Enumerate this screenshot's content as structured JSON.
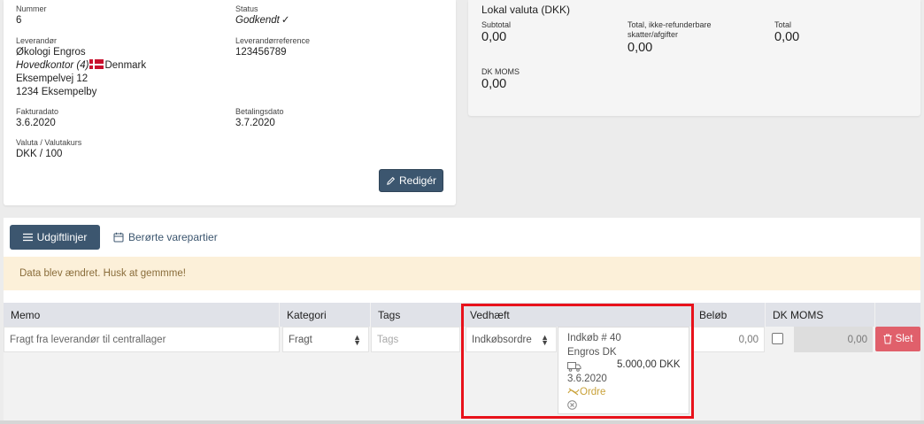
{
  "invoice": {
    "number_label": "Nummer",
    "number_value": "6",
    "status_label": "Status",
    "status_value": "Godkendt",
    "supplier_label": "Leverandør",
    "supplier_name": "Økologi Engros",
    "supplier_branch": "Hovedkontor (4)",
    "supplier_country": "Denmark",
    "supplier_street": "Eksempelvej 12",
    "supplier_city": "1234 Eksempelby",
    "supplier_ref_label": "Leverandørreference",
    "supplier_ref_value": "123456789",
    "invoice_date_label": "Fakturadato",
    "invoice_date_value": "3.6.2020",
    "payment_date_label": "Betalingsdato",
    "payment_date_value": "3.7.2020",
    "currency_label": "Valuta / Valutakurs",
    "currency_value": "DKK / 100",
    "edit_button": "Redigér"
  },
  "local_currency": {
    "title": "Lokal valuta (DKK)",
    "subtotal_label": "Subtotal",
    "subtotal_value": "0,00",
    "nonrefund_label_1": "Total, ikke-refunderbare",
    "nonrefund_label_2": "skatter/afgifter",
    "nonrefund_value": "0,00",
    "total_label": "Total",
    "total_value": "0,00",
    "vat_label": "DK MOMS",
    "vat_value": "0,00"
  },
  "tabs": {
    "expense_lines": "Udgiftlinjer",
    "affected_batches": "Berørte varepartier"
  },
  "alert": "Data blev ændret. Husk at gemmme!",
  "table": {
    "headers": [
      "Memo",
      "Kategori",
      "Tags",
      "Vedhæft",
      "Beløb",
      "DK MOMS"
    ],
    "row": {
      "memo": "Fragt fra leverandør til centrallager",
      "category": "Fragt",
      "tags_placeholder": "Tags",
      "attach_type": "Indkøbsordre",
      "amount": "0,00",
      "vat_amount": "0,00",
      "delete_button": "Slet"
    },
    "purchase": {
      "title": "Indkøb # 40",
      "supplier": "Engros DK",
      "amount": "5.000,00 DKK",
      "date": "3.6.2020",
      "link": "Ordre"
    }
  },
  "colors": {
    "primary": "#3c566f",
    "danger": "#e0606b",
    "alert_bg": "#fcf0d9",
    "highlight": "#e8121b",
    "link_gold": "#c9a23a"
  }
}
